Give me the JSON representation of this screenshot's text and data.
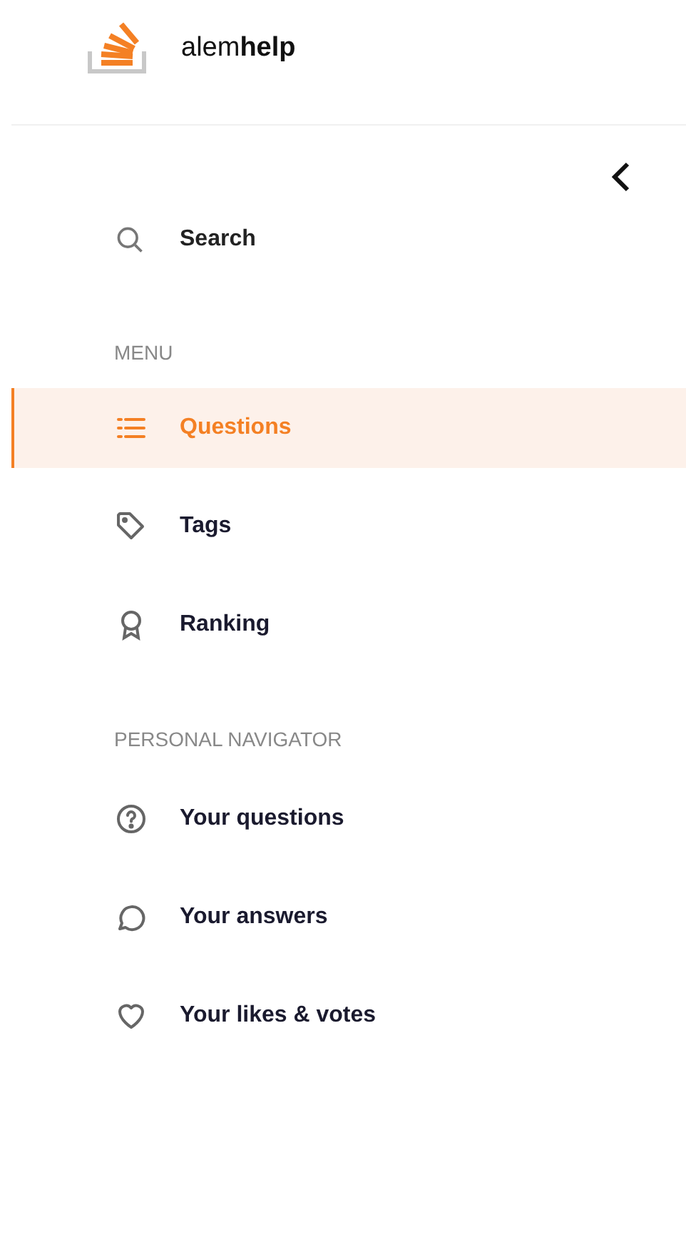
{
  "brand": {
    "name": "alem**help**"
  },
  "search": {
    "label": "Search"
  },
  "sections": [
    {
      "title": "MENU",
      "items": [
        {
          "kind": "list",
          "label": "Questions",
          "selected": true
        },
        {
          "kind": "tag",
          "label": "Tags",
          "selected": false
        },
        {
          "kind": "award",
          "label": "Ranking",
          "selected": false
        }
      ]
    },
    {
      "title": "PERSONAL NAVIGATOR",
      "items": [
        {
          "kind": "question",
          "label": "Your questions",
          "selected": false
        },
        {
          "kind": "chat",
          "label": "Your answers",
          "selected": false
        },
        {
          "kind": "heart",
          "label": "Your likes & votes",
          "selected": false
        }
      ]
    }
  ]
}
